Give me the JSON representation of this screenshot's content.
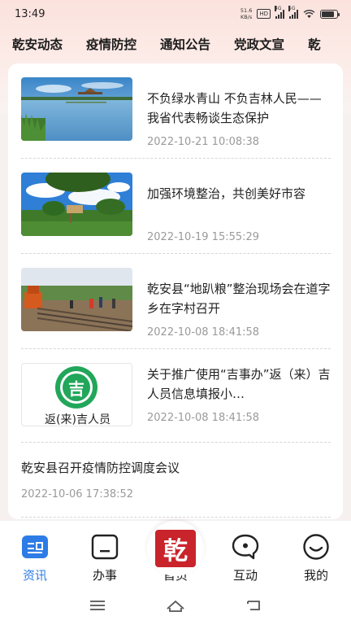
{
  "status_bar": {
    "time": "13:49",
    "net_speed_value": "51.6",
    "net_speed_unit": "KB/s",
    "hd_badge": "HD",
    "signal_1_tag": "4G",
    "signal_2_tag": "5G",
    "battery_level": 0.85
  },
  "tabs": [
    {
      "label": "乾安动态",
      "active": true
    },
    {
      "label": "疫情防控",
      "active": false
    },
    {
      "label": "通知公告",
      "active": false
    },
    {
      "label": "党政文宣",
      "active": false
    },
    {
      "label": "乾",
      "active": false
    }
  ],
  "articles": [
    {
      "title": "不负绿水青山 不负吉林人民——我省代表畅谈生态保护",
      "date": "2022-10-21 10:08:38",
      "thumb": "lake-wetland-image"
    },
    {
      "title": "加强环境整治，共创美好市容",
      "date": "2022-10-19 15:55:29",
      "thumb": "village-trees-image"
    },
    {
      "title": "乾安县“地趴粮”整治现场会在道字乡在字村召开",
      "date": "2022-10-08 18:41:58",
      "thumb": "construction-site-image"
    },
    {
      "title": "关于推广使用“吉事办”返（来）吉人员信息填报小…",
      "date": "2022-10-08 18:41:58",
      "thumb": "jishiban-logo-image",
      "thumb_logo_char": "吉",
      "thumb_caption": "返(来)吉人员"
    },
    {
      "title": "乾安县召开疫情防控调度会议",
      "date": "2022-10-06 17:38:52"
    }
  ],
  "bottom_nav": {
    "items": [
      {
        "label": "资讯",
        "icon": "news-icon",
        "active": true
      },
      {
        "label": "办事",
        "icon": "service-icon",
        "active": false
      },
      {
        "label": "首页",
        "icon": "home-seal-icon",
        "active": false,
        "seal_char": "乾"
      },
      {
        "label": "互动",
        "icon": "chat-icon",
        "active": false
      },
      {
        "label": "我的",
        "icon": "profile-icon",
        "active": false
      }
    ]
  },
  "colors": {
    "active_tab_underline": "#f2a02c",
    "active_nav": "#2d7ce6",
    "seal_red": "#c9232b",
    "date_gray": "#9a9a9a"
  }
}
